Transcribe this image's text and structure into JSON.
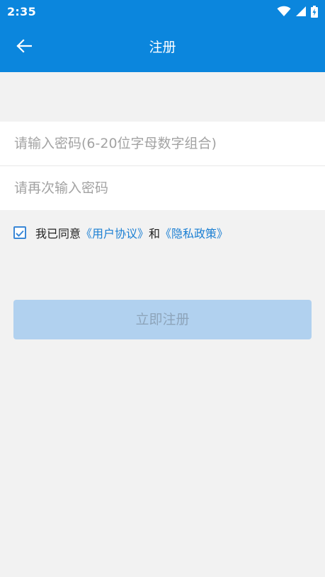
{
  "status_bar": {
    "time": "2:35",
    "icons": [
      "wifi-icon",
      "signal-icon",
      "battery-charging-icon"
    ]
  },
  "app_bar": {
    "title": "注册",
    "back_icon": "arrow-left-icon"
  },
  "form": {
    "password_placeholder": "请输入密码(6-20位字母数字组合)",
    "confirm_password_placeholder": "请再次输入密码"
  },
  "agreement": {
    "checked": true,
    "prefix": "我已同意",
    "user_agreement_link": "《用户协议》",
    "conjunction": "和",
    "privacy_policy_link": "《隐私政策》"
  },
  "register_button_label": "立即注册",
  "colors": {
    "primary": "#0b86dd",
    "background": "#f2f2f2",
    "link": "#1b7fd3",
    "button_disabled": "#b1d1ef"
  }
}
